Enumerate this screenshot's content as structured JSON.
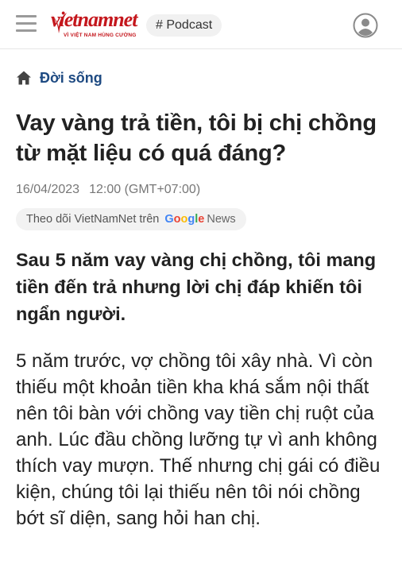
{
  "header": {
    "logo_text": "vietnamnet",
    "logo_tagline": "VÌ VIỆT NAM HÙNG CƯỜNG",
    "podcast_label": "# Podcast"
  },
  "breadcrumb": {
    "label": "Đời sống"
  },
  "article": {
    "title": "Vay vàng trả tiền, tôi bị chị chồng từ mặt liệu có quá đáng?",
    "date": "16/04/2023",
    "time": "12:00 (GMT+07:00)",
    "follow_text": "Theo dõi VietNamNet trên",
    "follow_brand_letters": [
      "G",
      "o",
      "o",
      "g",
      "l",
      "e"
    ],
    "follow_brand_suffix": "News",
    "lead": "Sau 5 năm vay vàng chị chồng, tôi mang tiền đến trả nhưng lời chị đáp khiến tôi ngẩn người.",
    "body": "5 năm trước, vợ chồng tôi xây nhà. Vì còn thiếu một khoản tiền kha khá sắm nội thất nên tôi bàn với chồng vay tiền chị ruột của anh. Lúc đầu chồng lưỡng tự vì anh không thích vay mượn. Thế nhưng chị gái có điều kiện, chúng tôi lại thiếu nên tôi nói chồng bớt sĩ diện, sang hỏi han chị."
  },
  "colors": {
    "brand_red": "#c4161c",
    "breadcrumb_blue": "#1e4a82",
    "google": [
      "#4285F4",
      "#EA4335",
      "#FBBC05",
      "#4285F4",
      "#34A853",
      "#EA4335"
    ]
  },
  "icons": {
    "menu": "menu-icon",
    "home": "home-icon",
    "account": "user-avatar-icon"
  }
}
